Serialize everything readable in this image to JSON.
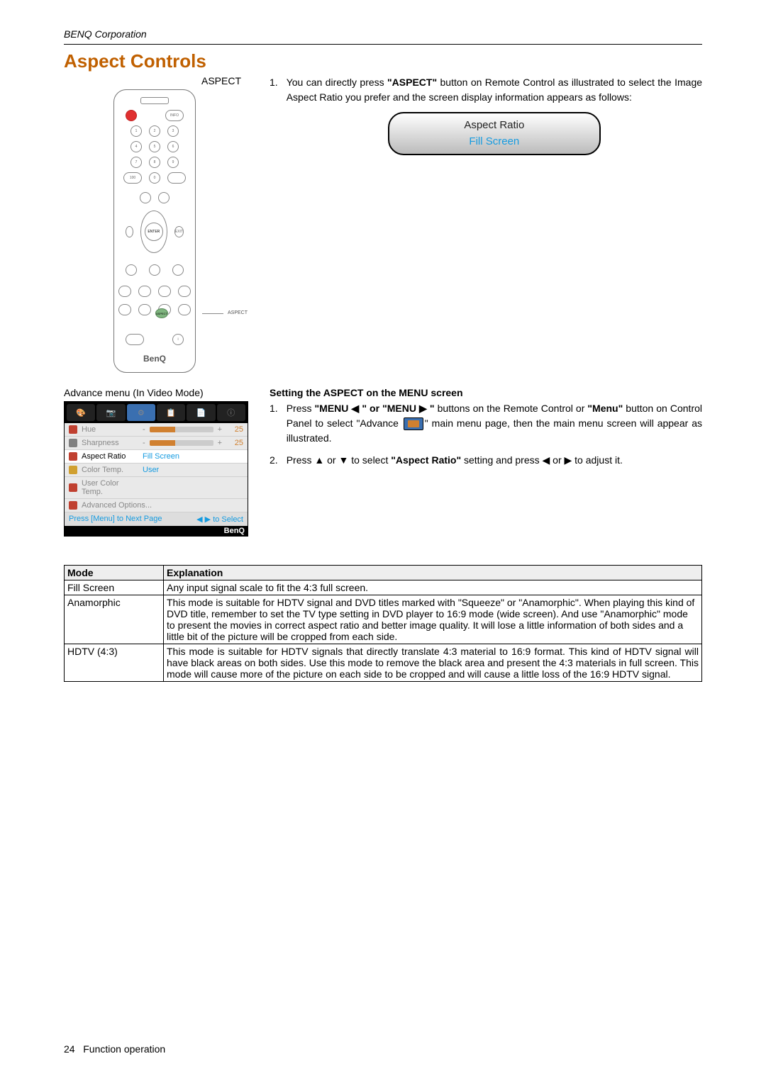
{
  "header": {
    "company": "BENQ Corporation"
  },
  "section": {
    "title": "Aspect Controls"
  },
  "remote": {
    "aspect_label": "ASPECT",
    "callout": "ASPECT",
    "brand": "BenQ"
  },
  "step1": {
    "num": "1.",
    "text_before": "You can directly press ",
    "button_label": "\"ASPECT\"",
    "text_after": " button on Remote Control as illustrated to select the Image Aspect Ratio you prefer and the screen display information appears as follows:"
  },
  "osd_bubble": {
    "title": "Aspect Ratio",
    "value": "Fill Screen"
  },
  "advance_label": "Advance menu (In Video Mode)",
  "osd_menu": {
    "rows": [
      {
        "label": "Hue",
        "value": "25",
        "slider": true,
        "hl": false,
        "ico": "#c04030"
      },
      {
        "label": "Sharpness",
        "value": "25",
        "slider": true,
        "hl": false,
        "ico": "#808080"
      },
      {
        "label": "Aspect Ratio",
        "txtval": "Fill Screen",
        "hl": true,
        "ico": "#c04030"
      },
      {
        "label": "Color Temp.",
        "txtval": "User",
        "hl": false,
        "ico": "#d0a030"
      },
      {
        "label": "User Color Temp.",
        "hl": false,
        "ico": "#c04030"
      },
      {
        "label": "Advanced Options...",
        "hl": false,
        "ico": "#c04030"
      }
    ],
    "footer_left": "Press [Menu] to Next Page",
    "footer_right": "◀ ▶ to Select",
    "brand": "BenQ"
  },
  "setting": {
    "title": "Setting the ASPECT on the MENU screen",
    "s1": {
      "num": "1.",
      "a": "Press ",
      "menu_l": "\"MENU ◀ \" or \"MENU ▶ \"",
      "b": " buttons on the Remote Control or ",
      "menu_btn": "\"Menu\"",
      "c": " button on Control Panel to select \"Advance ",
      "d": "\" main menu page, then the main menu screen will appear as illustrated."
    },
    "s2": {
      "num": "2.",
      "a": "Press ",
      "arrows1": "▲ or ▼",
      "b": " to select ",
      "target": "\"Aspect Ratio\"",
      "c": " setting and press ",
      "arrows2": "◀ or ▶",
      "d": " to adjust it."
    }
  },
  "table": {
    "headers": {
      "mode": "Mode",
      "explanation": "Explanation"
    },
    "rows": [
      {
        "mode": "Fill Screen",
        "explanation": "Any input signal scale to fit the 4:3 full screen."
      },
      {
        "mode": "Anamorphic",
        "explanation": "This mode is suitable for HDTV signal and DVD titles marked with \"Squeeze\" or \"Anamorphic\". When playing this kind of DVD title, remember to set the TV type setting in DVD player to 16:9 mode (wide screen). And use \"Anamorphic\" mode to present the movies in correct aspect ratio and better image quality. It will lose a little information of both sides and a little bit of the picture will be cropped from each side."
      },
      {
        "mode": "HDTV (4:3)",
        "explanation": "This mode is suitable for HDTV signals that directly translate 4:3 material to 16:9 format. This kind of HDTV signal will have black areas on both sides. Use this mode to remove the black area and present the 4:3 materials in full screen. This mode will cause more of the picture on each side to be cropped and will cause a little loss of the 16:9 HDTV signal."
      }
    ]
  },
  "footer": {
    "page": "24",
    "section": "Function operation"
  }
}
